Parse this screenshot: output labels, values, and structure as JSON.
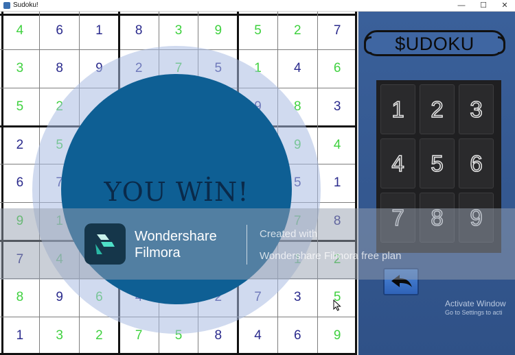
{
  "window": {
    "title": "Sudoku!",
    "min_glyph": "—",
    "max_glyph": "☐",
    "close_glyph": "✕"
  },
  "colors": {
    "given": "#2a2a8c",
    "entered": "#3fd13f"
  },
  "board": {
    "rows": [
      [
        {
          "v": "4",
          "t": "e"
        },
        {
          "v": "6",
          "t": "g"
        },
        {
          "v": "1",
          "t": "g"
        },
        {
          "v": "8",
          "t": "g"
        },
        {
          "v": "3",
          "t": "e"
        },
        {
          "v": "9",
          "t": "e"
        },
        {
          "v": "5",
          "t": "e"
        },
        {
          "v": "2",
          "t": "e"
        },
        {
          "v": "7",
          "t": "g"
        }
      ],
      [
        {
          "v": "3",
          "t": "e"
        },
        {
          "v": "8",
          "t": "g"
        },
        {
          "v": "9",
          "t": "g"
        },
        {
          "v": "2",
          "t": "g"
        },
        {
          "v": "7",
          "t": "e"
        },
        {
          "v": "5",
          "t": "g"
        },
        {
          "v": "1",
          "t": "e"
        },
        {
          "v": "4",
          "t": "g"
        },
        {
          "v": "6",
          "t": "e"
        }
      ],
      [
        {
          "v": "5",
          "t": "e"
        },
        {
          "v": "2",
          "t": "e"
        },
        {
          "v": "",
          "t": "g"
        },
        {
          "v": "",
          "t": "g"
        },
        {
          "v": "",
          "t": "g"
        },
        {
          "v": "",
          "t": "g"
        },
        {
          "v": "9",
          "t": "g"
        },
        {
          "v": "8",
          "t": "e"
        },
        {
          "v": "3",
          "t": "g"
        }
      ],
      [
        {
          "v": "2",
          "t": "g"
        },
        {
          "v": "5",
          "t": "e"
        },
        {
          "v": "",
          "t": "g"
        },
        {
          "v": "",
          "t": "g"
        },
        {
          "v": "",
          "t": "g"
        },
        {
          "v": "",
          "t": "g"
        },
        {
          "v": "",
          "t": "g"
        },
        {
          "v": "9",
          "t": "e"
        },
        {
          "v": "4",
          "t": "e"
        }
      ],
      [
        {
          "v": "6",
          "t": "g"
        },
        {
          "v": "7",
          "t": "g"
        },
        {
          "v": "",
          "t": "g"
        },
        {
          "v": "",
          "t": "g"
        },
        {
          "v": "",
          "t": "g"
        },
        {
          "v": "",
          "t": "g"
        },
        {
          "v": "",
          "t": "g"
        },
        {
          "v": "5",
          "t": "g"
        },
        {
          "v": "1",
          "t": "g"
        }
      ],
      [
        {
          "v": "9",
          "t": "e"
        },
        {
          "v": "1",
          "t": "e"
        },
        {
          "v": "",
          "t": "g"
        },
        {
          "v": "",
          "t": "g"
        },
        {
          "v": "",
          "t": "g"
        },
        {
          "v": "",
          "t": "g"
        },
        {
          "v": "",
          "t": "g"
        },
        {
          "v": "7",
          "t": "e"
        },
        {
          "v": "8",
          "t": "g"
        }
      ],
      [
        {
          "v": "7",
          "t": "g"
        },
        {
          "v": "4",
          "t": "e"
        },
        {
          "v": "",
          "t": "g"
        },
        {
          "v": "",
          "t": "g"
        },
        {
          "v": "",
          "t": "g"
        },
        {
          "v": "",
          "t": "g"
        },
        {
          "v": "",
          "t": "g"
        },
        {
          "v": "1",
          "t": "e"
        },
        {
          "v": "2",
          "t": "e"
        }
      ],
      [
        {
          "v": "8",
          "t": "e"
        },
        {
          "v": "9",
          "t": "g"
        },
        {
          "v": "6",
          "t": "e"
        },
        {
          "v": "4",
          "t": "g"
        },
        {
          "v": "",
          "t": "g"
        },
        {
          "v": "2",
          "t": "g"
        },
        {
          "v": "7",
          "t": "g"
        },
        {
          "v": "3",
          "t": "g"
        },
        {
          "v": "5",
          "t": "e"
        }
      ],
      [
        {
          "v": "1",
          "t": "g"
        },
        {
          "v": "3",
          "t": "e"
        },
        {
          "v": "2",
          "t": "e"
        },
        {
          "v": "7",
          "t": "e"
        },
        {
          "v": "5",
          "t": "e"
        },
        {
          "v": "8",
          "t": "g"
        },
        {
          "v": "4",
          "t": "g"
        },
        {
          "v": "6",
          "t": "g"
        },
        {
          "v": "9",
          "t": "e"
        }
      ]
    ]
  },
  "panel": {
    "title": "$UDOKU",
    "keys": [
      "1",
      "2",
      "3",
      "4",
      "5",
      "6",
      "7",
      "8",
      "9"
    ],
    "undo_icon": "undo-arrow-icon"
  },
  "overlay": {
    "message": "YOU WİN!"
  },
  "watermark": {
    "brand_line1": "Wondershare",
    "brand_line2": "Filmora",
    "created": "Created with",
    "plan": "Wondershare Filmora free plan"
  },
  "os_notice": {
    "line1": "Activate Window",
    "line2": "Go to Settings to acti"
  }
}
